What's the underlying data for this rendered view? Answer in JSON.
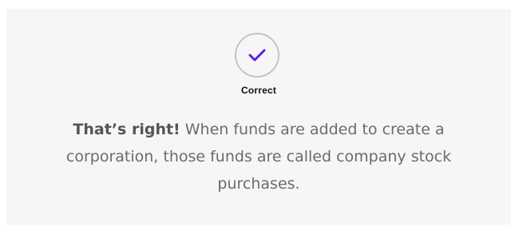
{
  "result": {
    "status_label": "Correct",
    "icon": "checkmark-icon",
    "accent_color": "#5b21e6"
  },
  "feedback": {
    "lead": "That’s right!",
    "body": "When funds are added to create a corporation, those funds are called company stock purchases."
  }
}
